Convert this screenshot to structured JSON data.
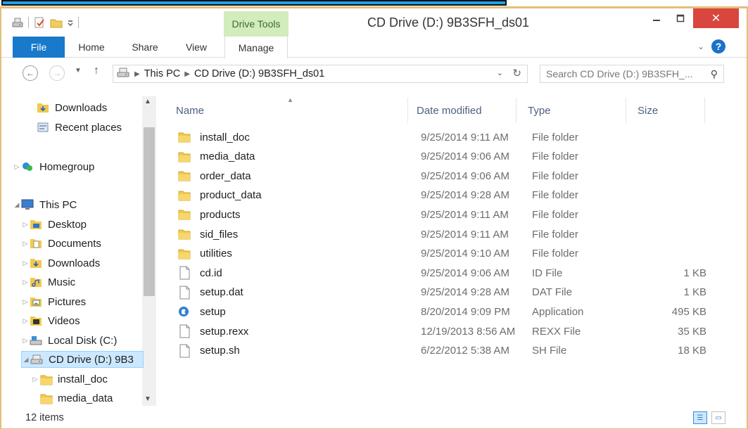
{
  "window": {
    "title": "CD Drive (D:) 9B3SFH_ds01",
    "context_tab_title": "Drive Tools",
    "minimize": "–",
    "maximize": "□",
    "close": "✕"
  },
  "ribbon": {
    "tabs": [
      "File",
      "Home",
      "Share",
      "View",
      "Manage"
    ]
  },
  "address": {
    "crumbs": [
      "This PC",
      "CD Drive (D:) 9B3SFH_ds01"
    ],
    "search_placeholder": "Search CD Drive (D:) 9B3SFH_..."
  },
  "navpane": {
    "items": [
      {
        "label": "Downloads",
        "icon": "downloads-folder-icon"
      },
      {
        "label": "Recent places",
        "icon": "recent-places-icon"
      },
      {
        "label": "Homegroup",
        "icon": "homegroup-icon"
      },
      {
        "label": "This PC",
        "icon": "computer-icon"
      },
      {
        "label": "Desktop",
        "icon": "desktop-folder-icon"
      },
      {
        "label": "Documents",
        "icon": "documents-folder-icon"
      },
      {
        "label": "Downloads",
        "icon": "downloads-folder-icon"
      },
      {
        "label": "Music",
        "icon": "music-folder-icon"
      },
      {
        "label": "Pictures",
        "icon": "pictures-folder-icon"
      },
      {
        "label": "Videos",
        "icon": "videos-folder-icon"
      },
      {
        "label": "Local Disk (C:)",
        "icon": "local-disk-icon"
      },
      {
        "label": "CD Drive (D:) 9B3",
        "icon": "cd-drive-icon"
      },
      {
        "label": "install_doc",
        "icon": "folder-icon"
      },
      {
        "label": "media_data",
        "icon": "folder-icon"
      }
    ]
  },
  "columns": {
    "name": "Name",
    "date": "Date modified",
    "type": "Type",
    "size": "Size"
  },
  "files": [
    {
      "name": "install_doc",
      "date": "9/25/2014 9:11 AM",
      "type": "File folder",
      "size": "",
      "icon": "folder-icon"
    },
    {
      "name": "media_data",
      "date": "9/25/2014 9:06 AM",
      "type": "File folder",
      "size": "",
      "icon": "folder-icon"
    },
    {
      "name": "order_data",
      "date": "9/25/2014 9:06 AM",
      "type": "File folder",
      "size": "",
      "icon": "folder-icon"
    },
    {
      "name": "product_data",
      "date": "9/25/2014 9:28 AM",
      "type": "File folder",
      "size": "",
      "icon": "folder-icon"
    },
    {
      "name": "products",
      "date": "9/25/2014 9:11 AM",
      "type": "File folder",
      "size": "",
      "icon": "folder-icon"
    },
    {
      "name": "sid_files",
      "date": "9/25/2014 9:11 AM",
      "type": "File folder",
      "size": "",
      "icon": "folder-icon"
    },
    {
      "name": "utilities",
      "date": "9/25/2014 9:10 AM",
      "type": "File folder",
      "size": "",
      "icon": "folder-icon"
    },
    {
      "name": "cd.id",
      "date": "9/25/2014 9:06 AM",
      "type": "ID File",
      "size": "1 KB",
      "icon": "file-icon"
    },
    {
      "name": "setup.dat",
      "date": "9/25/2014 9:28 AM",
      "type": "DAT File",
      "size": "1 KB",
      "icon": "file-icon"
    },
    {
      "name": "setup",
      "date": "8/20/2014 9:09 PM",
      "type": "Application",
      "size": "495 KB",
      "icon": "application-icon"
    },
    {
      "name": "setup.rexx",
      "date": "12/19/2013 8:56 AM",
      "type": "REXX File",
      "size": "35 KB",
      "icon": "file-icon"
    },
    {
      "name": "setup.sh",
      "date": "6/22/2012 5:38 AM",
      "type": "SH File",
      "size": "18 KB",
      "icon": "file-icon"
    }
  ],
  "status": {
    "count": "12 items"
  },
  "colors": {
    "file_tab": "#1979ca",
    "close_button": "#d9463e",
    "drive_tools": "#d2ecbc",
    "selection": "#cce8ff",
    "window_border": "#e3bf7c"
  }
}
